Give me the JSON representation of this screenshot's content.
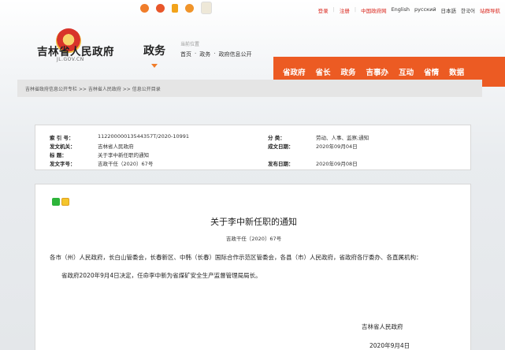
{
  "topbar": {
    "social_icons": [
      "weibo-icon",
      "weibo-alt-icon",
      "mobile-icon",
      "accessibility-icon",
      "mascot-icon"
    ],
    "links": {
      "login": "登录",
      "register": "注册",
      "china_gov": "中国政府网",
      "english": "English",
      "russian": "русский",
      "japanese": "日本語",
      "korean": "한국어",
      "elderly": "站群导航"
    }
  },
  "header": {
    "site_name": "吉林省人民政府",
    "site_domain": "JL.GOV.CN",
    "section": "政务",
    "location_label": "当前位置",
    "breadcrumbs": [
      "首页",
      "·",
      "政务",
      "·",
      "政府信息公开"
    ],
    "nav": [
      "省政府",
      "省长",
      "政务",
      "吉事办",
      "互动",
      "省情",
      "数据"
    ]
  },
  "pathbar": "吉林省政府信息公开专栏 >> 吉林省人民政府 >> 信息公开目录",
  "meta": {
    "index_label": "索 引 号：",
    "index_value": "11220000013544357T/2020-10991",
    "category_label": "分 类：",
    "category_value": "劳动、人事、监察;通知",
    "issuer_label": "发文机关：",
    "issuer_value": "吉林省人民政府",
    "created_label": "成文日期：",
    "created_value": "2020年09月04日",
    "title_label": "标    题：",
    "title_value": "关于李中新任职的通知",
    "docno_label": "发文字号：",
    "docno_value": "吉政干任（2020）67号",
    "published_label": "发布日期：",
    "published_value": "2020年09月08日"
  },
  "document": {
    "title": "关于李中新任职的通知",
    "number": "吉政干任〔2020〕67号",
    "recipients": "各市（州）人民政府，长白山管委会，长春新区、中韩（长春）国际合作示范区管委会，各县（市）人民政府，省政府各厅委办、各直属机构：",
    "body": "省政府2020年9月4日决定，任命李中新为省煤矿安全生产监督管理局局长。",
    "signer": "吉林省人民政府",
    "date": "2020年9月4日"
  }
}
